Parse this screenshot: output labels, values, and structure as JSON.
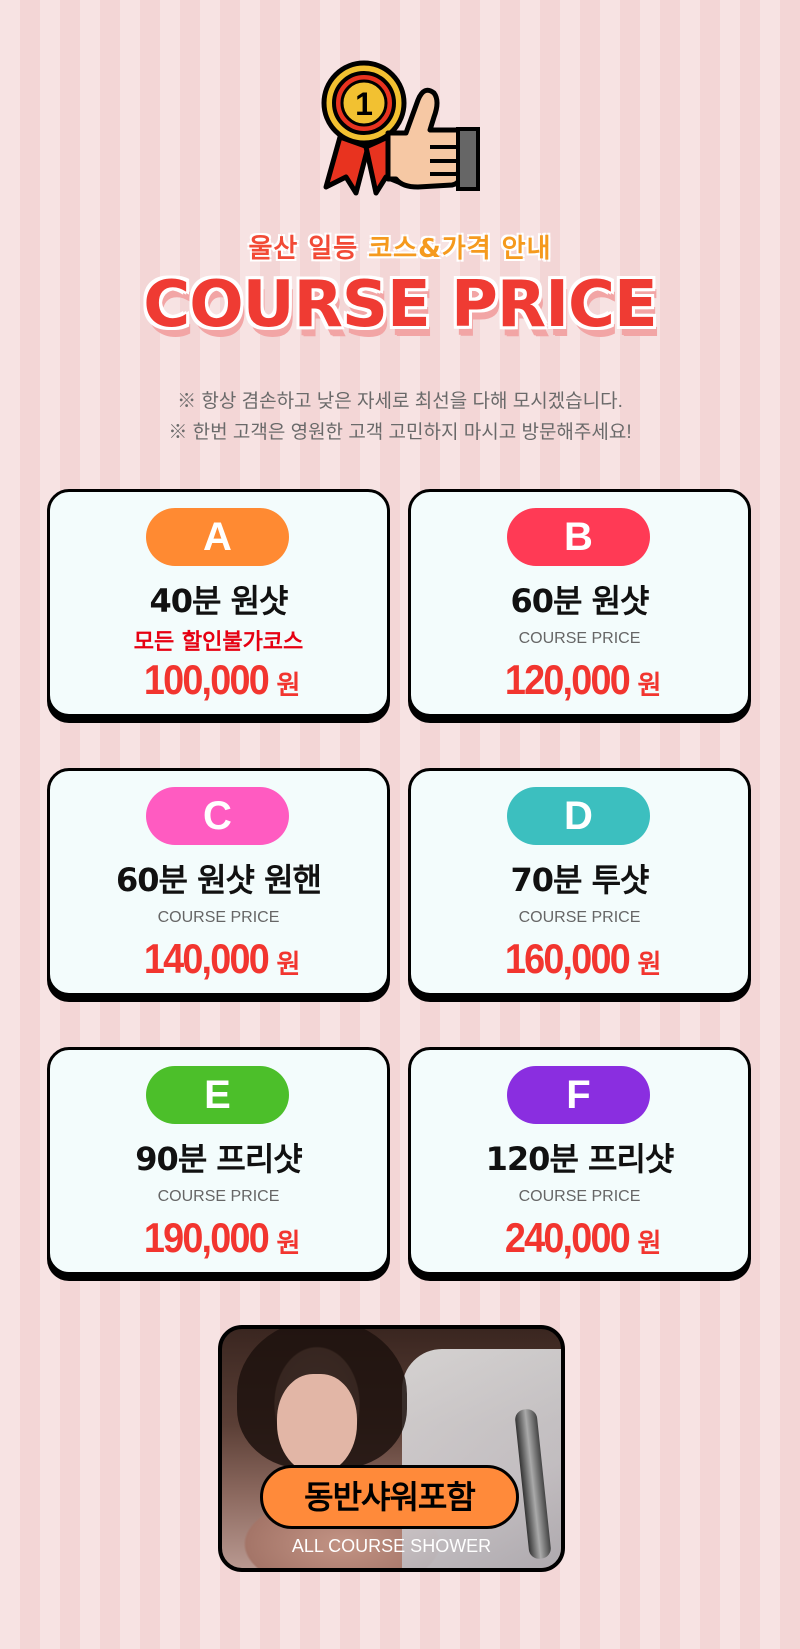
{
  "header": {
    "subtitle_part1": "울산 일등 ",
    "subtitle_part2": "코스&가격 안내",
    "title": "COURSE PRICE",
    "note1": "※ 항상 겸손하고 낮은 자세로 최선을 다해 모시겠습니다.",
    "note2": "※ 한번 고객은 영원한 고객 고민하지 마시고 방문해주세요!",
    "medal_number": "1"
  },
  "courses": [
    {
      "letter": "A",
      "color": "#ff8a32",
      "title": "40분 원샷",
      "sub": "모든 할인불가코스",
      "price": "100,000",
      "unit": "원"
    },
    {
      "letter": "B",
      "color": "#ff3a55",
      "title": "60분 원샷",
      "sub": "COURSE PRICE",
      "price": "120,000",
      "unit": "원"
    },
    {
      "letter": "C",
      "color": "#ff5bc1",
      "title": "60분 원샷 원핸",
      "sub": "COURSE PRICE",
      "price": "140,000",
      "unit": "원"
    },
    {
      "letter": "D",
      "color": "#3cbfbf",
      "title": "70분 투샷",
      "sub": "COURSE PRICE",
      "price": "160,000",
      "unit": "원"
    },
    {
      "letter": "E",
      "color": "#4cbf2a",
      "title": "90분 프리샷",
      "sub": "COURSE PRICE",
      "price": "190,000",
      "unit": "원"
    },
    {
      "letter": "F",
      "color": "#8a2ee0",
      "title": "120분 프리샷",
      "sub": "COURSE PRICE",
      "price": "240,000",
      "unit": "원"
    }
  ],
  "footer": {
    "badge": "동반샤워포함",
    "caption": "ALL COURSE SHOWER"
  }
}
